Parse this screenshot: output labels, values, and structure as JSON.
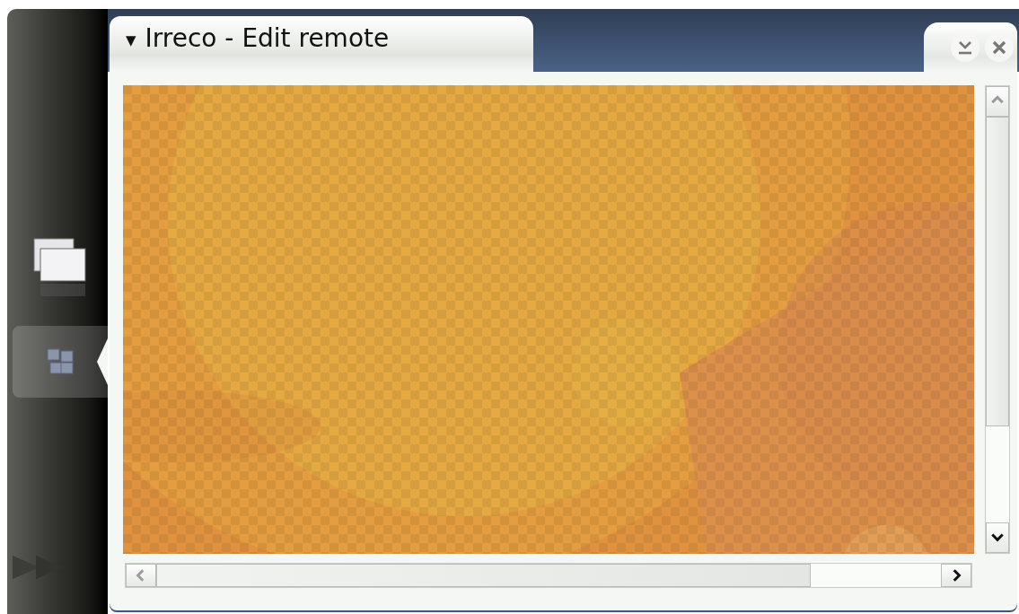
{
  "window": {
    "menu_indicator": "▼",
    "title": "Irreco - Edit remote"
  },
  "sidebar": {
    "items": [
      {
        "kind": "windows",
        "selected": false
      },
      {
        "kind": "apps",
        "selected": true
      },
      {
        "kind": "forward",
        "selected": false
      }
    ]
  }
}
